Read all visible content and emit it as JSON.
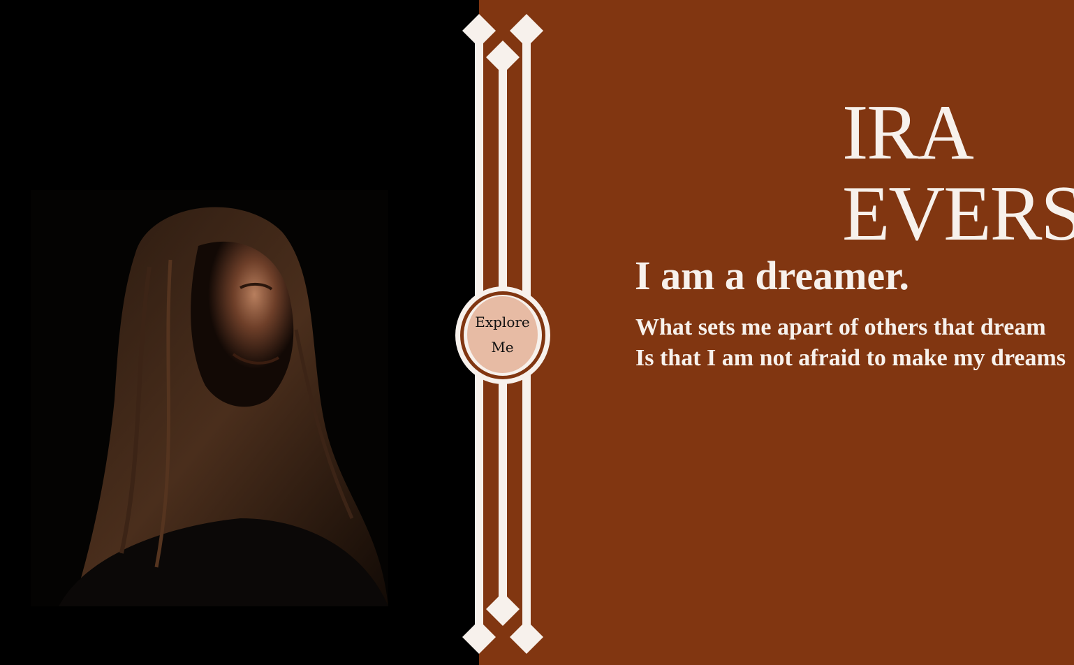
{
  "hero": {
    "name_first": "IRA",
    "name_last": "EVERS",
    "tagline": "I am a dreamer.",
    "description_line1": "What sets me apart of others that dream",
    "description_line2": "Is that I am not afraid to make my dreams"
  },
  "explore_button": {
    "label_line1": "Explore",
    "label_line2": "Me"
  },
  "colors": {
    "left_background": "#000000",
    "right_background": "#813611",
    "ornament": "#f7f1ec",
    "button_fill": "#e7bba4",
    "text": "#f7f1ec"
  },
  "icons": {
    "ornament": "diamond-line-ornament-icon"
  }
}
